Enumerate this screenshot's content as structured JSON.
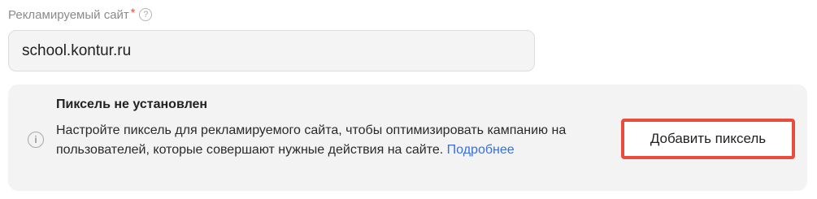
{
  "field": {
    "label": "Рекламируемый сайт",
    "required_mark": "*",
    "help_icon": "question-circle-icon",
    "value": "school.kontur.ru"
  },
  "notice": {
    "icon": "info-circle-icon",
    "title": "Пиксель не установлен",
    "text": "Настройте пиксель для рекламируемого сайта, чтобы оптимизировать кампанию на пользователей, которые совершают нужные действия на сайте.",
    "link_label": "Подробнее",
    "button_label": "Добавить пиксель"
  },
  "colors": {
    "required": "#e84a3c",
    "link": "#3a6fd8",
    "button_highlight": "#e94b3c",
    "notice_bg": "#f3f3f3"
  }
}
